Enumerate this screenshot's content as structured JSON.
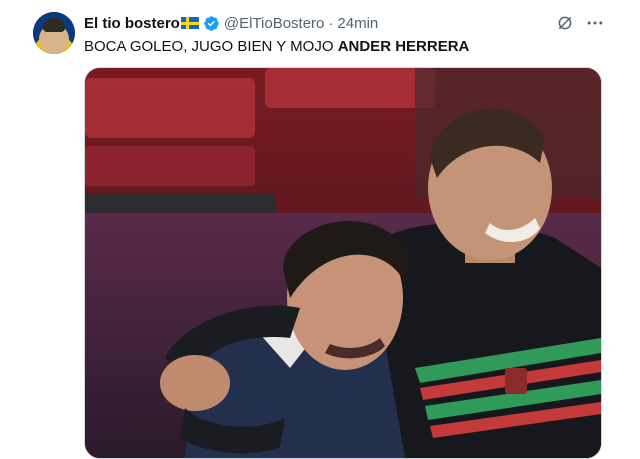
{
  "tweet": {
    "author_name": "El tio bostero",
    "author_flag": "sweden-flag",
    "verified_icon": "verified-badge-icon",
    "handle": "@ElTioBostero",
    "separator": "·",
    "time": "24min",
    "text_plain": "BOCA GOLEO, JUGO BIEN Y MOJO ",
    "text_bold": "ANDER HERRERA",
    "media": {
      "description_icon": "video-thumbnail",
      "accent": "#e8434f"
    },
    "actions": {
      "grok_icon": "grok-icon",
      "more_icon": "more-icon"
    }
  },
  "colors": {
    "text": "#0f1419",
    "muted": "#536471",
    "verified": "#1d9bf0"
  }
}
